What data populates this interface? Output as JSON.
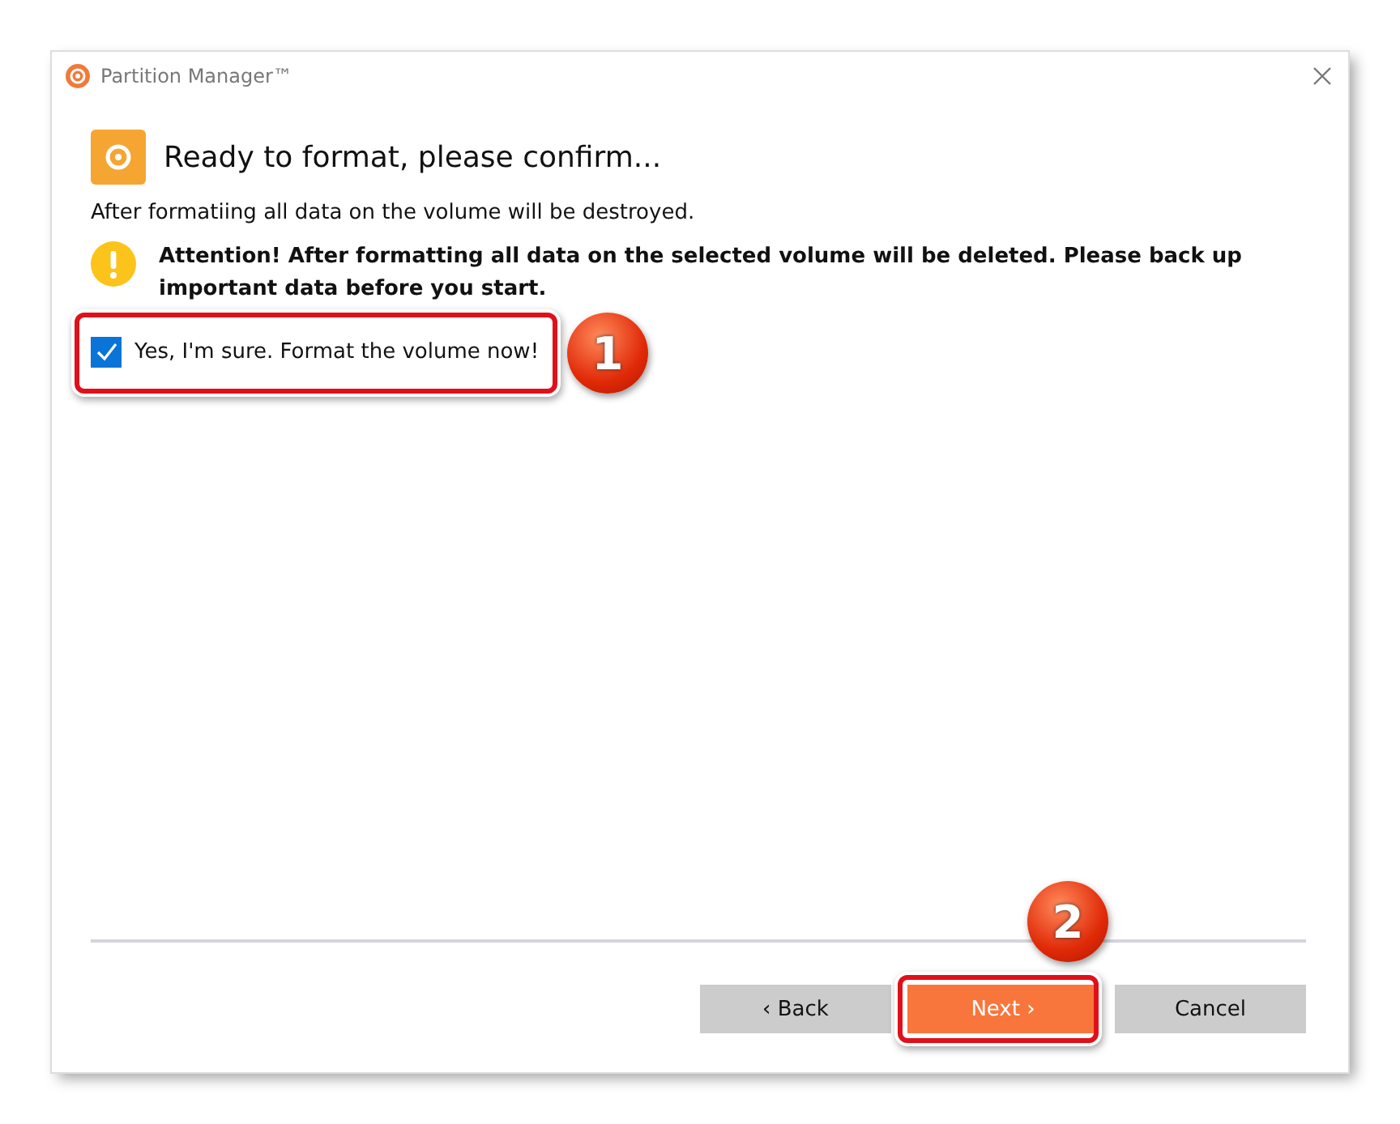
{
  "window": {
    "title": "Partition Manager™"
  },
  "heading": "Ready to format, please confirm...",
  "description": "After formatiing all data on the volume will be destroyed.",
  "warning": "Attention! After formatting all data on the selected volume will be deleted. Please back up important data before you start.",
  "confirm": {
    "label": "Yes, I'm sure. Format the volume now!",
    "checked": true
  },
  "buttons": [
    {
      "label": "‹ Back",
      "kind": "plain"
    },
    {
      "label": "Next ›",
      "kind": "primary"
    },
    {
      "label": "Cancel",
      "kind": "plain"
    }
  ],
  "callouts": [
    "1",
    "2"
  ]
}
